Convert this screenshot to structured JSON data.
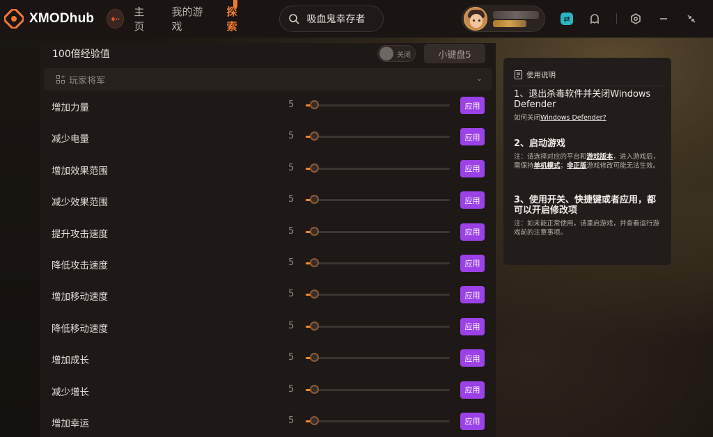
{
  "app": {
    "name": "XMODhub",
    "accent": "#f07a2f",
    "apply_color": "#9b41e8"
  },
  "nav": {
    "items": [
      {
        "label": "主页",
        "active": false
      },
      {
        "label": "我的游戏",
        "active": false
      },
      {
        "label": "探索",
        "active": true
      }
    ]
  },
  "search": {
    "value": "吸血鬼幸存者",
    "icon": "search-icon"
  },
  "window_icons": [
    "sync-icon",
    "ghost-icon",
    "settings-icon",
    "minimize-icon",
    "collapse-icon"
  ],
  "top_option": {
    "label": "100倍经验值",
    "toggle_label": "关闭",
    "hotkey_label": "小键盘5"
  },
  "section": {
    "title": "玩家将军"
  },
  "cheats": [
    {
      "label": "增加力量",
      "value": "5",
      "apply": "应用"
    },
    {
      "label": "减少电量",
      "value": "5",
      "apply": "应用"
    },
    {
      "label": "增加效果范围",
      "value": "5",
      "apply": "应用"
    },
    {
      "label": "减少效果范围",
      "value": "5",
      "apply": "应用"
    },
    {
      "label": "提升攻击速度",
      "value": "5",
      "apply": "应用"
    },
    {
      "label": "降低攻击速度",
      "value": "5",
      "apply": "应用"
    },
    {
      "label": "增加移动速度",
      "value": "5",
      "apply": "应用"
    },
    {
      "label": "降低移动速度",
      "value": "5",
      "apply": "应用"
    },
    {
      "label": "增加成长",
      "value": "5",
      "apply": "应用"
    },
    {
      "label": "减少增长",
      "value": "5",
      "apply": "应用"
    },
    {
      "label": "增加幸运",
      "value": "5",
      "apply": "应用"
    }
  ],
  "slider_level": 0.04,
  "help": {
    "title": "使用说明",
    "step1_title": "1、退出杀毒软件并关闭Windows Defender",
    "step1_note_prefix": "如何关闭",
    "step1_note_link": "Windows Defender?",
    "step2_title": "2、启动游戏",
    "step2_note_a": "注：请选择对应的平台和",
    "step2_note_b": "游戏版本",
    "step2_note_c": "，进入游戏后，需保持",
    "step2_note_d": "单机模式",
    "step2_note_e": "；",
    "step2_note_f": "非正版",
    "step2_note_g": "游戏修改可能无法生效。",
    "step3_title": "3、使用开关、快捷键或者应用，都可以开启修改项",
    "step3_note": "注：如未能正常使用，请重启游戏，并查看运行游戏前的注意事项。"
  }
}
